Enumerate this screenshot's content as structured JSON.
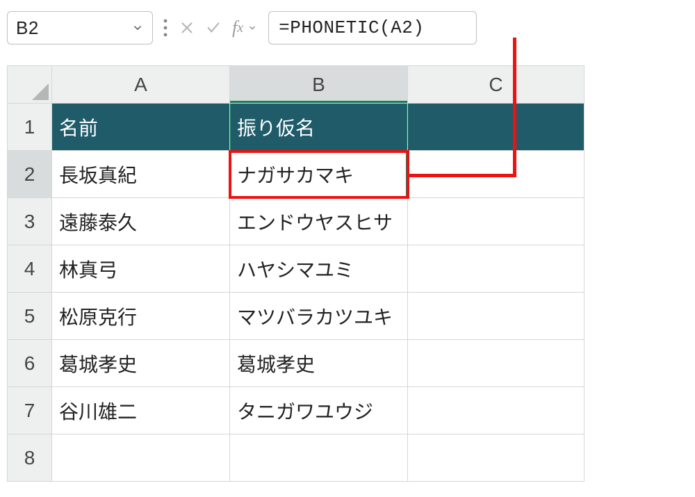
{
  "formula_bar": {
    "cell_ref": "B2",
    "formula": "=PHONETIC(A2)"
  },
  "columns": {
    "A": "A",
    "B": "B",
    "C": "C"
  },
  "rows": [
    "1",
    "2",
    "3",
    "4",
    "5",
    "6",
    "7",
    "8"
  ],
  "headers": {
    "A": "名前",
    "B": "振り仮名"
  },
  "data": {
    "r2": {
      "A": "長坂真紀",
      "B": "ナガサカマキ"
    },
    "r3": {
      "A": "遠藤泰久",
      "B": "エンドウヤスヒサ"
    },
    "r4": {
      "A": "林真弓",
      "B": "ハヤシマユミ"
    },
    "r5": {
      "A": "松原克行",
      "B": "マツバラカツユキ"
    },
    "r6": {
      "A": "葛城孝史",
      "B": "葛城孝史"
    },
    "r7": {
      "A": "谷川雄二",
      "B": "タニガワユウジ"
    }
  },
  "chart_data": {
    "type": "table",
    "columns": [
      "名前",
      "振り仮名"
    ],
    "rows": [
      [
        "長坂真紀",
        "ナガサカマキ"
      ],
      [
        "遠藤泰久",
        "エンドウヤスヒサ"
      ],
      [
        "林真弓",
        "ハヤシマユミ"
      ],
      [
        "松原克行",
        "マツバラカツユキ"
      ],
      [
        "葛城孝史",
        "葛城孝史"
      ],
      [
        "谷川雄二",
        "タニガワユウジ"
      ]
    ]
  }
}
